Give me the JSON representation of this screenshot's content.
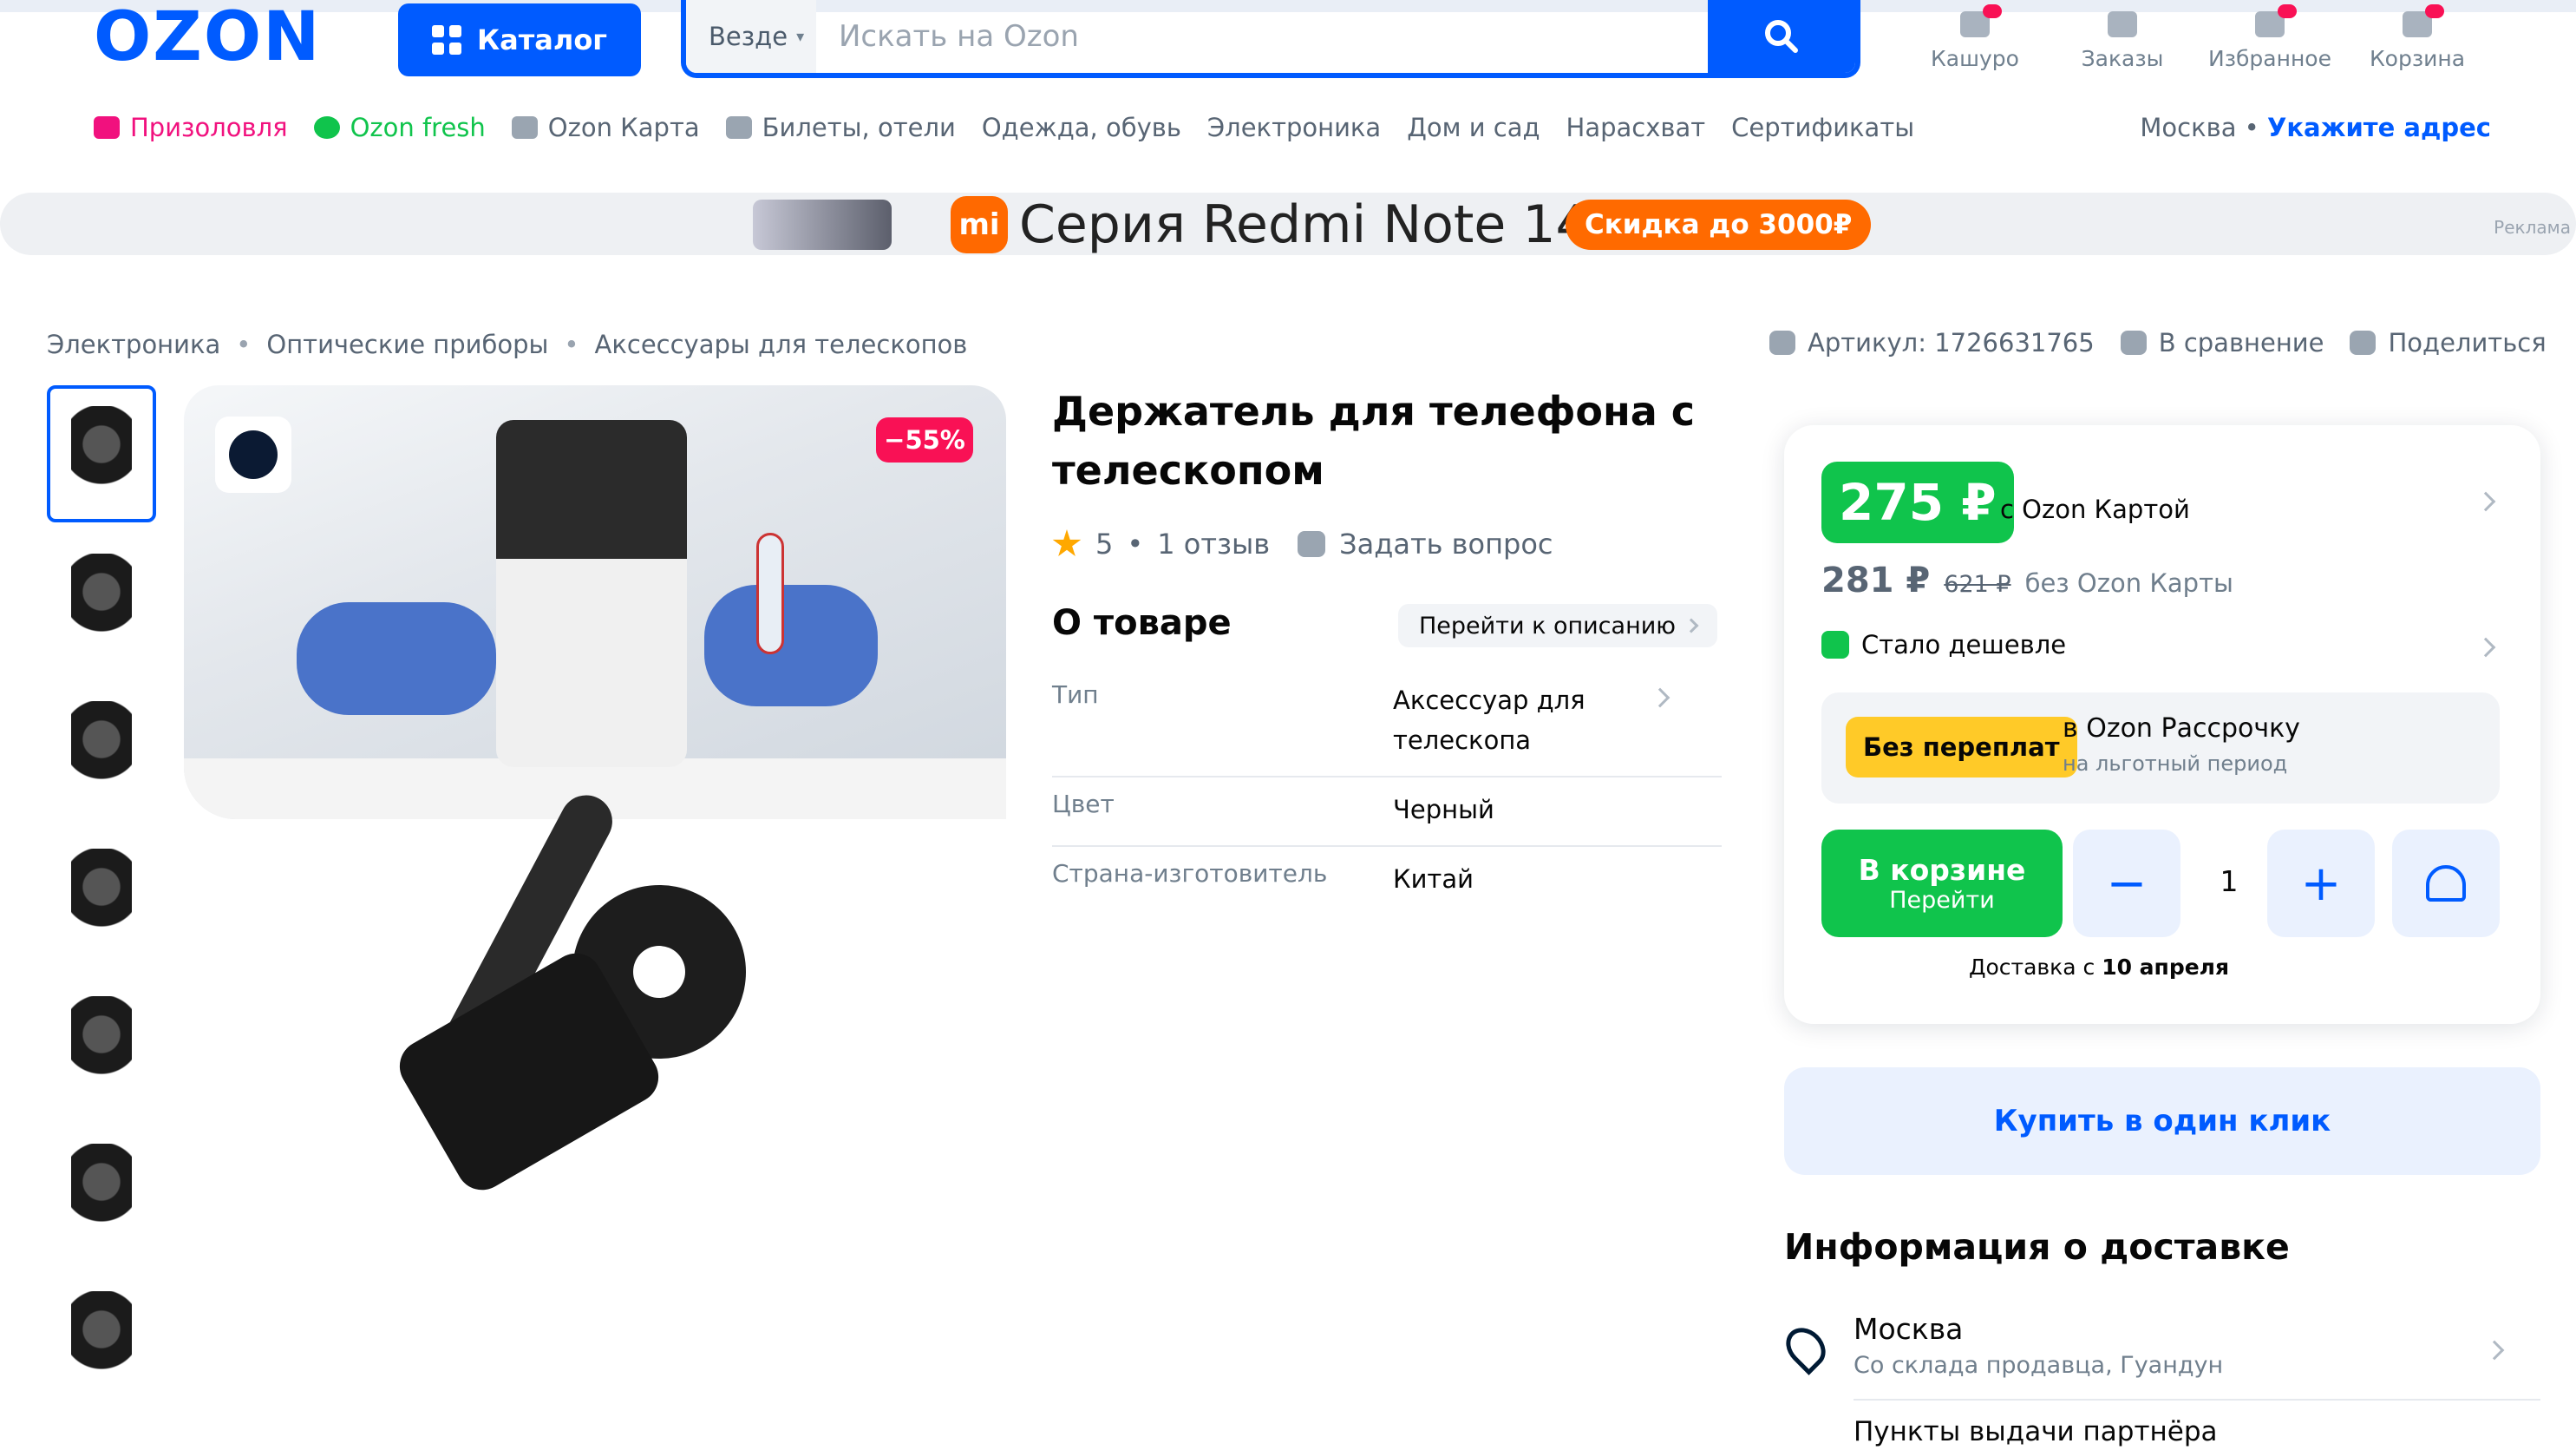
{
  "header": {
    "logo": "OZON",
    "catalog_label": "Каталог",
    "search": {
      "scope": "Везде",
      "placeholder": "Искать на Ozon"
    },
    "links": [
      {
        "label": "Кашуро",
        "icon": "user-icon"
      },
      {
        "label": "Заказы",
        "icon": "box-icon"
      },
      {
        "label": "Избранное",
        "icon": "heart-icon"
      },
      {
        "label": "Корзина",
        "icon": "cart-icon"
      }
    ]
  },
  "nav": {
    "items": [
      "Призоловля",
      "Ozon fresh",
      "Ozon Карта",
      "Билеты, отели",
      "Одежда, обувь",
      "Электроника",
      "Дом и сад",
      "Нарасхват",
      "Сертификаты"
    ],
    "city": "Москва",
    "address_link": "Укажите адрес"
  },
  "banner": {
    "title": "Серия Redmi Note 14",
    "promo": "Скидка до 3000₽",
    "ad_label": "Реклама",
    "brand_mark": "mi"
  },
  "breadcrumbs": [
    "Электроника",
    "Оптические приборы",
    "Аксессуары для телескопов"
  ],
  "meta": {
    "article": "Артикул: 1726631765",
    "compare": "В сравнение",
    "share": "Поделиться"
  },
  "product": {
    "title": "Держатель для телефона с телескопом",
    "discount": "−55%",
    "rating": "5",
    "reviews": "1 отзыв",
    "ask_question": "Задать вопрос",
    "thumbnail_count": 7
  },
  "about": {
    "heading": "О товаре",
    "goto_description": "Перейти к описанию",
    "specs": [
      {
        "key": "Тип",
        "value": "Аксессуар для телескопа"
      },
      {
        "key": "Цвет",
        "value": "Черный"
      },
      {
        "key": "Страна-изготовитель",
        "value": "Китай"
      }
    ]
  },
  "buy": {
    "price_card": "275 ₽",
    "price_card_label": "с Ozon Картой",
    "price": "281 ₽",
    "old_price": "621 ₽",
    "price_label": "без Ozon Карты",
    "cheaper": "Стало дешевле",
    "installment_tag": "Без переплат",
    "installment_title": "в Ozon Рассрочку",
    "installment_sub": "на льготный период",
    "cart_label": "В корзине",
    "cart_sub": "Перейти",
    "minus": "−",
    "plus": "+",
    "quantity": "1",
    "delivery_prefix": "Доставка с ",
    "delivery_date": "10 апреля"
  },
  "one_click": "Купить в один клик",
  "delivery": {
    "heading": "Информация о доставке",
    "city": "Москва",
    "source": "Со склада продавца, Гуандун",
    "next": "Пункты выдачи партнёра"
  },
  "colors": {
    "brand": "#005bff",
    "green": "#10c44c",
    "pink": "#f91155",
    "orange": "#ff6a00",
    "yellow": "#ffca28"
  }
}
